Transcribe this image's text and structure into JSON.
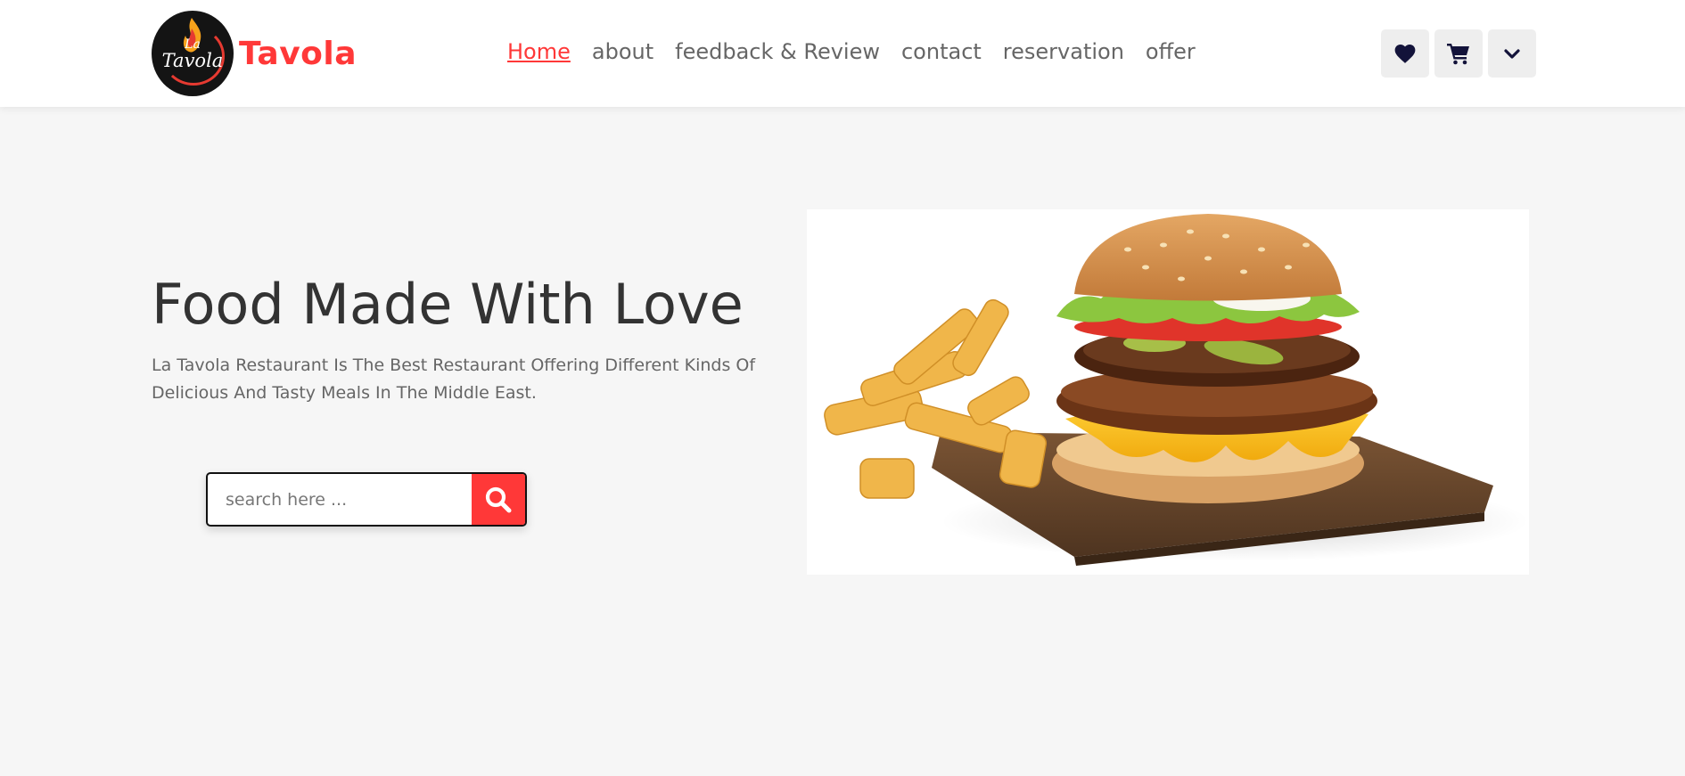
{
  "header": {
    "brand": "Tavola",
    "logo_text_top": "La",
    "logo_text_main": "Tavola",
    "nav": [
      {
        "label": "Home",
        "active": true
      },
      {
        "label": "about",
        "active": false
      },
      {
        "label": "feedback & Review",
        "active": false
      },
      {
        "label": "contact",
        "active": false
      },
      {
        "label": "reservation",
        "active": false
      },
      {
        "label": "offer",
        "active": false
      }
    ],
    "icons": [
      "heart-icon",
      "cart-icon",
      "chevron-down-icon"
    ]
  },
  "hero": {
    "title": "Food Made With Love",
    "subtitle": "La Tavola Restaurant Is The Best Restaurant Offering Different Kinds Of Delicious And Tasty Meals In The Middle East.",
    "search": {
      "placeholder": "search here ...",
      "value": ""
    },
    "image": "burger-and-fries-image"
  },
  "colors": {
    "accent": "#ff3838",
    "icon": "#13133a",
    "background": "#f6f6f6"
  }
}
